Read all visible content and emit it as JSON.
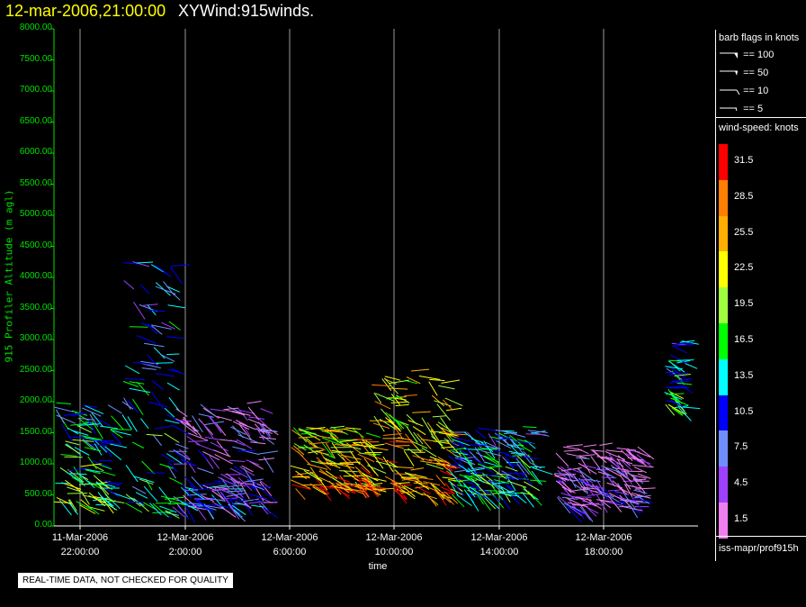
{
  "header": {
    "date_time": "12-mar-2006,21:00:00",
    "field_title": "XYWind:915winds."
  },
  "chart_data": {
    "type": "wind-barb profile",
    "ylabel": "915 Profiler Altitude (m agl)",
    "xlabel": "time",
    "ylim": [
      0,
      8000
    ],
    "y_ticks": [
      "0.00",
      "500.00",
      "1000.00",
      "1500.00",
      "2000.00",
      "2500.00",
      "3000.00",
      "3500.00",
      "4000.00",
      "4500.00",
      "5000.00",
      "5500.00",
      "6000.00",
      "6500.00",
      "7000.00",
      "7500.00",
      "8000.00"
    ],
    "x_ticks": [
      {
        "date": "11-Mar-2006",
        "time": "22:00:00"
      },
      {
        "date": "12-Mar-2006",
        "time": "2:00:00"
      },
      {
        "date": "12-Mar-2006",
        "time": "6:00:00"
      },
      {
        "date": "12-Mar-2006",
        "time": "10:00:00"
      },
      {
        "date": "12-Mar-2006",
        "time": "14:00:00"
      },
      {
        "date": "12-Mar-2006",
        "time": "18:00:00"
      }
    ],
    "grid": "vertical",
    "clusters": [
      {
        "time": "11-Mar 21:00-23:00",
        "alt_min": 300,
        "alt_max": 2000,
        "speed": 18
      },
      {
        "time": "11-Mar 23:30-01:30",
        "alt_min": 200,
        "alt_max": 4400,
        "speed": 15
      },
      {
        "time": "12-Mar 01:30-05:00",
        "alt_min": 300,
        "alt_max": 2000,
        "speed": 8
      },
      {
        "time": "12-Mar 06:00-09:00",
        "alt_min": 600,
        "alt_max": 1600,
        "speed": 27
      },
      {
        "time": "12-Mar 09:00-12:00",
        "alt_min": 500,
        "alt_max": 2500,
        "speed": 27
      },
      {
        "time": "12-Mar 12:00-15:00",
        "alt_min": 500,
        "alt_max": 1600,
        "speed": 16
      },
      {
        "time": "12-Mar 16:00-19:00",
        "alt_min": 300,
        "alt_max": 1300,
        "speed": 6
      },
      {
        "time": "12-Mar 20:00-21:00",
        "alt_min": 1900,
        "alt_max": 3000,
        "speed": 17
      }
    ]
  },
  "legend": {
    "barb_title": "barb flags in knots",
    "barb_items": [
      "== 100",
      "== 50",
      "== 10",
      "== 5"
    ],
    "speed_title": "wind-speed: knots",
    "speed_levels": [
      {
        "label": "31.5",
        "color": "#ff0000"
      },
      {
        "label": "28.5",
        "color": "#ff7f00"
      },
      {
        "label": "25.5",
        "color": "#ffaf00"
      },
      {
        "label": "22.5",
        "color": "#ffff00"
      },
      {
        "label": "19.5",
        "color": "#9fff3f"
      },
      {
        "label": "16.5",
        "color": "#00ff00"
      },
      {
        "label": "13.5",
        "color": "#00ffff"
      },
      {
        "label": "10.5",
        "color": "#0000ff"
      },
      {
        "label": "7.5",
        "color": "#6f8fff"
      },
      {
        "label": "4.5",
        "color": "#9f3fff"
      },
      {
        "label": "1.5",
        "color": "#ef7fef"
      }
    ],
    "source": "iss-mapr/prof915h"
  },
  "footer": {
    "quality_note": "REAL-TIME DATA, NOT CHECKED FOR QUALITY"
  }
}
